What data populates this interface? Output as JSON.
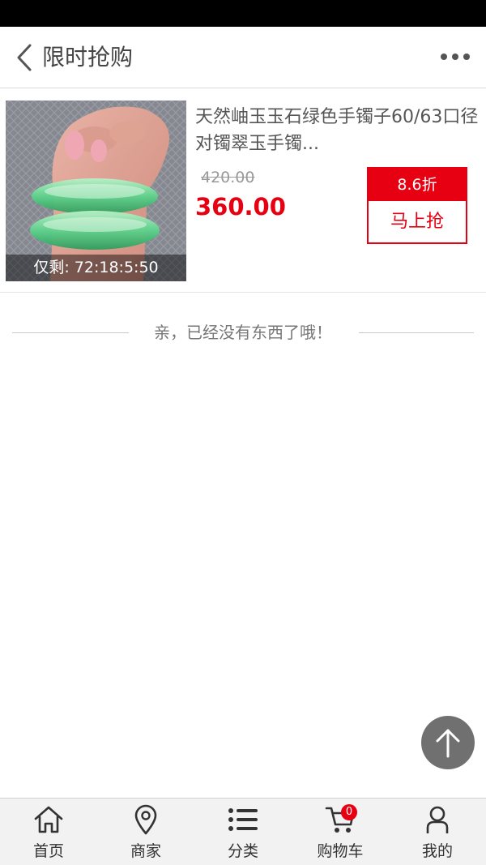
{
  "header": {
    "title": "限时抢购"
  },
  "product": {
    "name": "天然岫玉玉石绿色手镯子60/63口径对镯翠玉手镯...",
    "original_price": "420.00",
    "price": "360.00",
    "discount": "8.6折",
    "buy_label": "马上抢",
    "countdown": "仅剩: 72:18:5:50"
  },
  "end_note": "亲，已经没有东西了哦！",
  "tabbar": {
    "items": [
      {
        "label": "首页",
        "icon": "home-icon"
      },
      {
        "label": "商家",
        "icon": "location-pin-icon"
      },
      {
        "label": "分类",
        "icon": "list-icon"
      },
      {
        "label": "购物车",
        "icon": "cart-icon",
        "badge": "0"
      },
      {
        "label": "我的",
        "icon": "user-icon"
      }
    ]
  },
  "colors": {
    "accent": "#e60012",
    "header_text": "#444444",
    "tabbar_bg": "#f2f2f2"
  }
}
